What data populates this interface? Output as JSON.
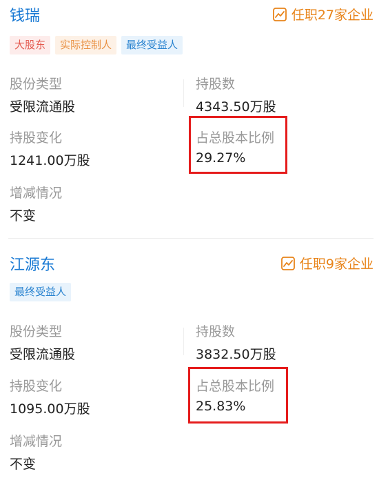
{
  "holders": [
    {
      "name": "钱瑞",
      "jobs": "任职27家企业",
      "tags": [
        "大股东",
        "实际控制人",
        "最终受益人"
      ],
      "share_type_label": "股份类型",
      "share_type": "受限流通股",
      "shares_label": "持股数",
      "shares": "4343.50万股",
      "change_label": "持股变化",
      "change": "1241.00万股",
      "ratio_label": "占总股本比例",
      "ratio": "29.27%",
      "trend_label": "增减情况",
      "trend": "不变"
    },
    {
      "name": "江源东",
      "jobs": "任职9家企业",
      "tags": [
        "最终受益人"
      ],
      "share_type_label": "股份类型",
      "share_type": "受限流通股",
      "shares_label": "持股数",
      "shares": "3832.50万股",
      "change_label": "持股变化",
      "change": "1095.00万股",
      "ratio_label": "占总股本比例",
      "ratio": "25.83%",
      "trend_label": "增减情况",
      "trend": "不变"
    }
  ],
  "colors": {
    "name": "#1778d3",
    "jobs": "#e8841a",
    "label": "#999999",
    "highlight": "#e51c1c"
  },
  "icons": {
    "jobs": "trend-chart-icon"
  }
}
